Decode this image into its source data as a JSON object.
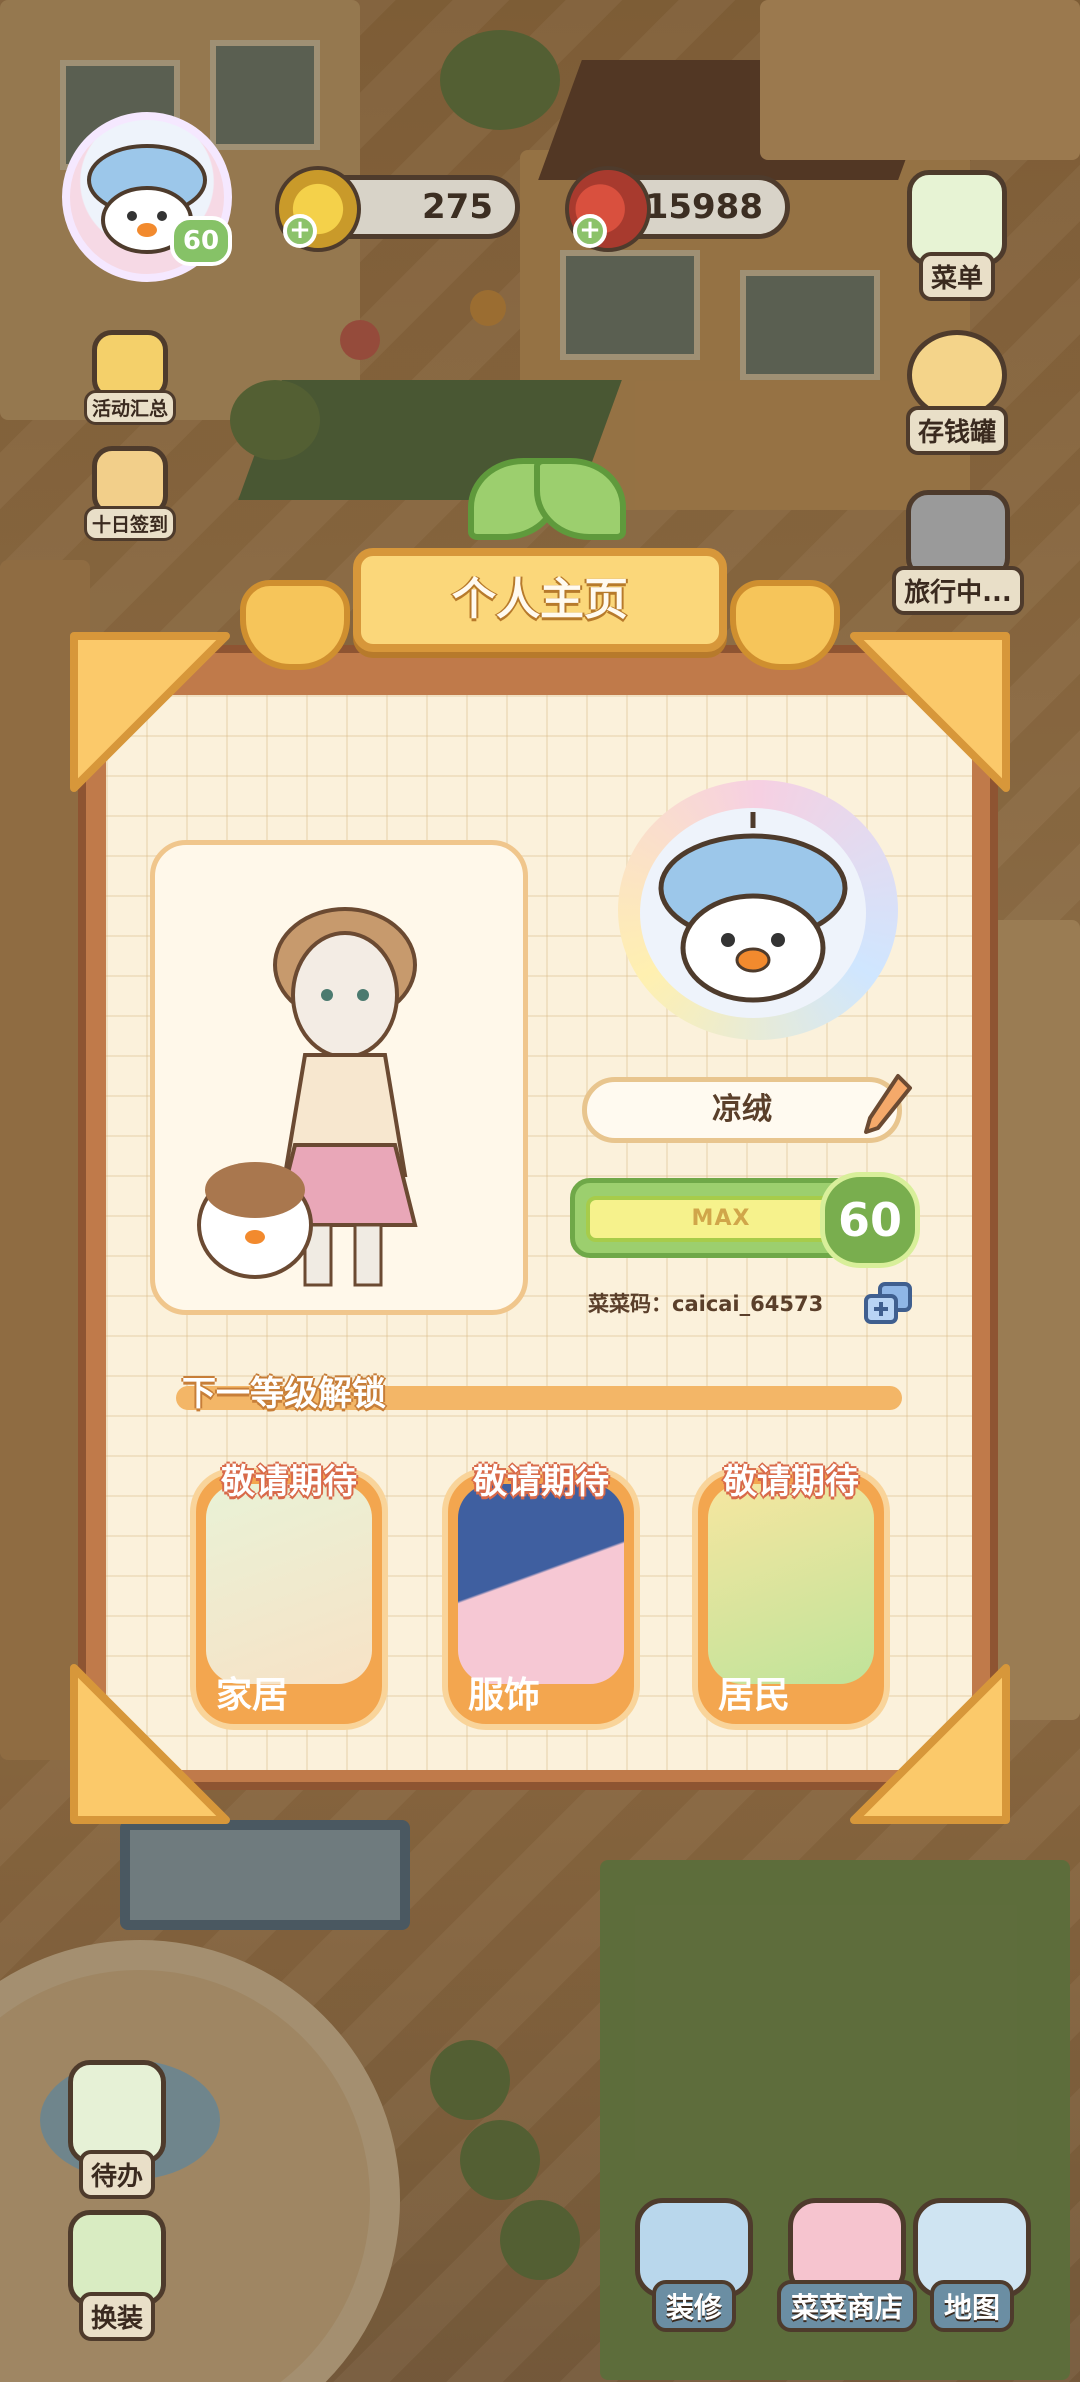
{
  "hud": {
    "player_level": "60",
    "coins": "275",
    "ingredients": "15988"
  },
  "right_menu": [
    {
      "label": "菜单",
      "icon": "menu-book-icon"
    },
    {
      "label": "存钱罐",
      "icon": "piggy-bank-icon"
    },
    {
      "label": "旅行中...",
      "icon": "camera-icon"
    }
  ],
  "left_menu": [
    {
      "label": "活动汇总",
      "icon": "event-icon"
    },
    {
      "label": "十日签到",
      "icon": "calendar-checkin-icon"
    },
    {
      "label": "待办",
      "icon": "todo-clipboard-icon"
    },
    {
      "label": "换装",
      "icon": "dress-up-icon"
    }
  ],
  "bottom_menu": [
    {
      "label": "装修",
      "icon": "decorate-icon"
    },
    {
      "label": "菜菜商店",
      "icon": "shop-icon"
    },
    {
      "label": "地图",
      "icon": "map-icon"
    }
  ],
  "profile": {
    "title": "个人主页",
    "name": "凉绒",
    "level_bar_text": "MAX",
    "level": "60",
    "code": "菜菜码：caicai_64573",
    "section_title": "下一等级解锁",
    "unlock_cards": [
      {
        "badge": "敬请期待",
        "label": "家居"
      },
      {
        "badge": "敬请期待",
        "label": "服饰"
      },
      {
        "badge": "敬请期待",
        "label": "居民"
      }
    ]
  },
  "colors": {
    "panel_border": "#8e5432",
    "panel_bg": "#fbf1db",
    "accent_orange": "#f3a64f",
    "accent_green": "#9ccf6e",
    "title_gold": "#fbd77a"
  }
}
